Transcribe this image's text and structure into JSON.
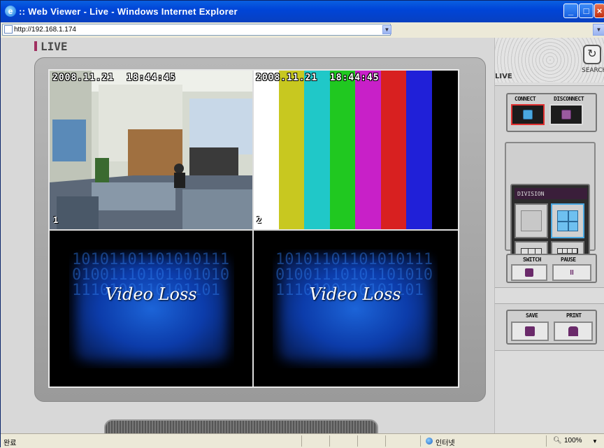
{
  "window": {
    "title": ":: Web Viewer - Live - Windows Internet Explorer"
  },
  "address": {
    "url": "http://192.168.1.174"
  },
  "page": {
    "logo": "LIVE"
  },
  "channels": [
    {
      "timestamp": "2008.11.21  18:44:45",
      "number": "1"
    },
    {
      "timestamp": "2008.11.21  18:44:45",
      "number": "2"
    },
    {
      "text": "Video Loss"
    },
    {
      "text": "Video Loss"
    }
  ],
  "color_bars": [
    "#ffffff",
    "#c8c820",
    "#20c8c8",
    "#20c820",
    "#c820c8",
    "#d82020",
    "#2020d8",
    "#000000"
  ],
  "panel": {
    "search_label": "SEARCH",
    "live_label": "LIVE",
    "connect_label": "CONNECT",
    "disconnect_label": "DISCONNECT",
    "division_title": "DIVISION",
    "switch_label": "SWITCH",
    "pause_label": "PAUSE",
    "save_label": "SAVE",
    "print_label": "PRINT"
  },
  "status": {
    "left": "완료",
    "zone": "인터넷",
    "zoom": "100%"
  }
}
